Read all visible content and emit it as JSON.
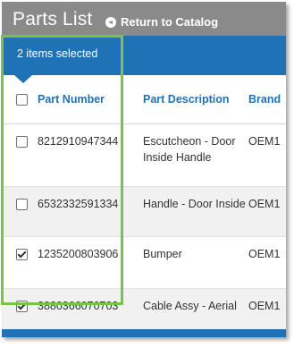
{
  "header": {
    "title": "Parts List",
    "return_label": "Return to Catalog"
  },
  "selection": {
    "text": "2 items selected"
  },
  "table": {
    "columns": [
      "Part Number",
      "Part Description",
      "Brand"
    ],
    "rows": [
      {
        "checked": false,
        "part_number": "8212910947344",
        "description": "Escutcheon - Door Inside Handle",
        "brand": "OEM1"
      },
      {
        "checked": false,
        "part_number": "6532332591334",
        "description": "Handle - Door Inside",
        "brand": "OEM1"
      },
      {
        "checked": true,
        "part_number": "1235200803906",
        "description": "Bumper",
        "brand": "OEM1"
      },
      {
        "checked": true,
        "part_number": "3880366070703",
        "description": "Cable Assy - Aerial",
        "brand": "OEM1"
      }
    ]
  },
  "colors": {
    "accent": "#1f72b6",
    "header_gray": "#8a8a8a",
    "highlight_green": "#7dc242"
  },
  "icons": {
    "return": "circle-arrow-left-icon",
    "checkbox": "checkbox-icon"
  }
}
